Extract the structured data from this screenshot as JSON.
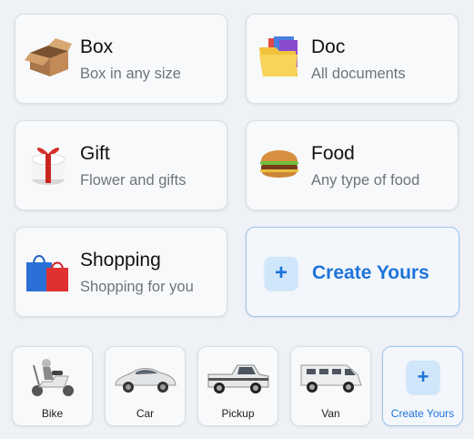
{
  "categories": [
    {
      "title": "Box",
      "subtitle": "Box in any size",
      "icon": "box-icon"
    },
    {
      "title": "Doc",
      "subtitle": "All documents",
      "icon": "folder-documents-icon"
    },
    {
      "title": "Gift",
      "subtitle": "Flower and gifts",
      "icon": "gift-icon"
    },
    {
      "title": "Food",
      "subtitle": "Any type of food",
      "icon": "burger-icon"
    },
    {
      "title": "Shopping",
      "subtitle": "Shopping for you",
      "icon": "shopping-bags-icon"
    }
  ],
  "create_card": {
    "plus": "+",
    "label": "Create Yours"
  },
  "vehicles": [
    {
      "label": "Bike",
      "icon": "scooter-icon"
    },
    {
      "label": "Car",
      "icon": "car-icon"
    },
    {
      "label": "Pickup",
      "icon": "pickup-truck-icon"
    },
    {
      "label": "Van",
      "icon": "van-icon"
    }
  ],
  "vehicle_create": {
    "plus": "+",
    "label": "Create Yours"
  },
  "colors": {
    "accent": "#1e73d9",
    "accent_light": "#cfe6fb",
    "background": "#eef1f6"
  }
}
